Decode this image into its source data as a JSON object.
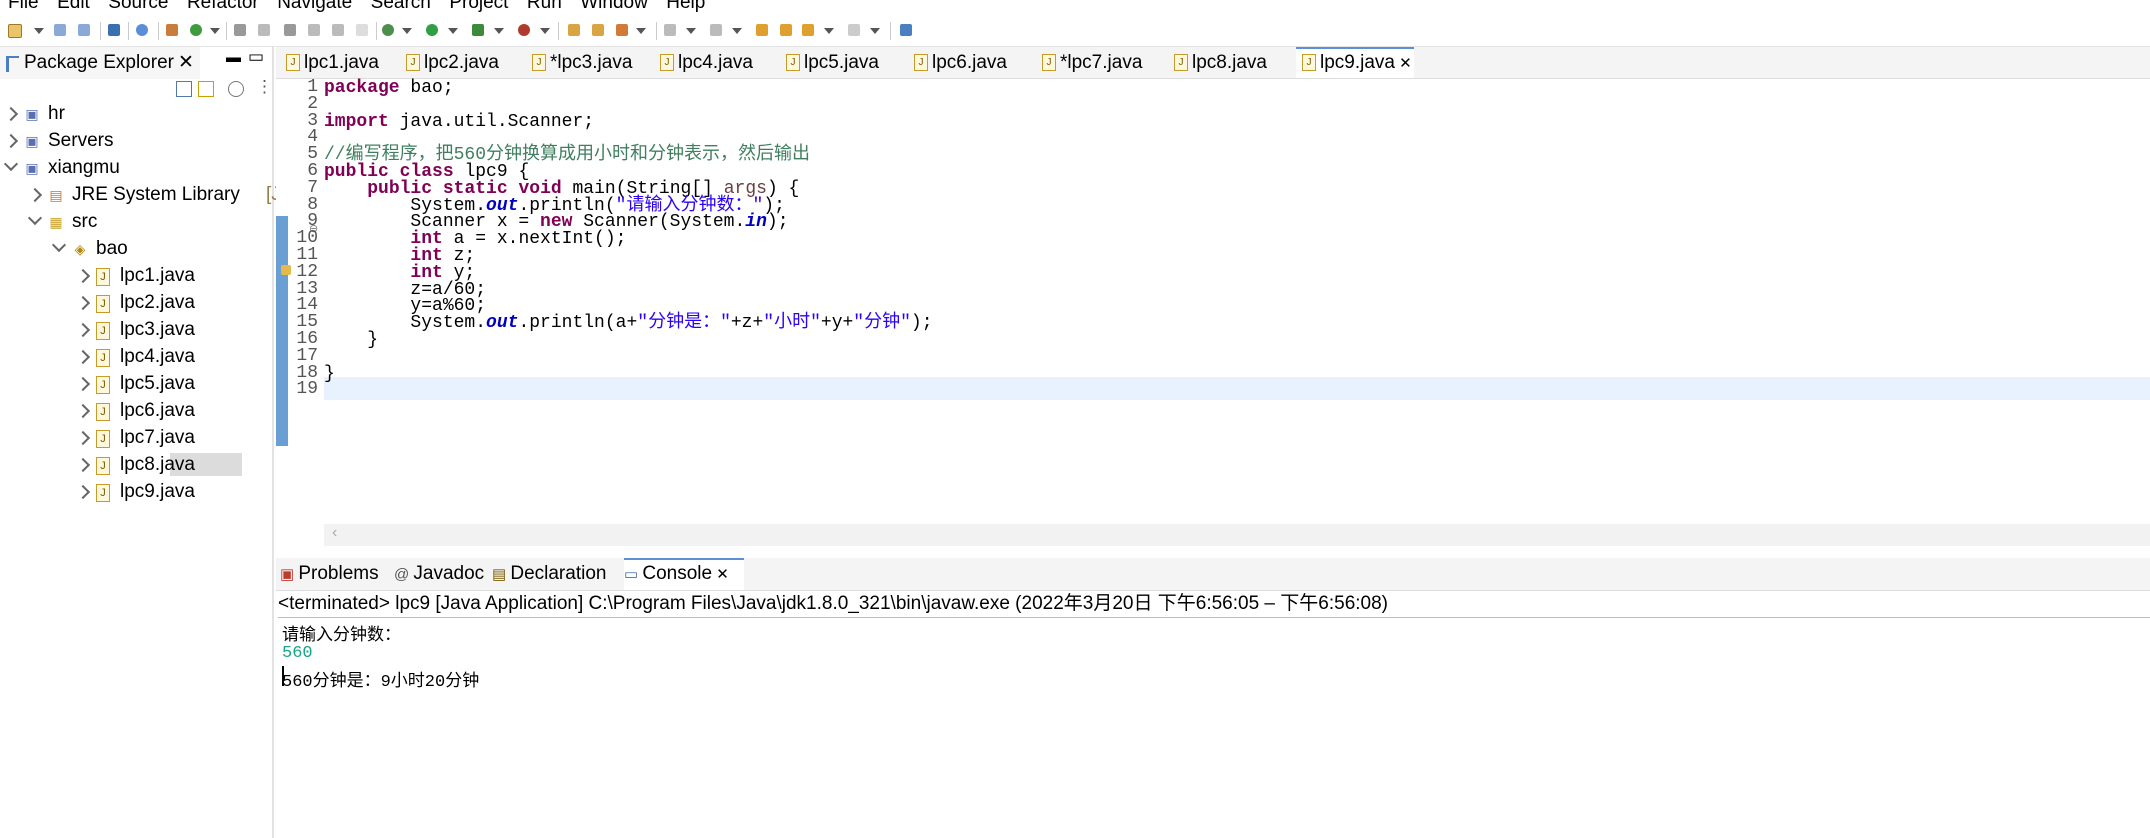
{
  "menu": [
    "File",
    "Edit",
    "Source",
    "Refactor",
    "Navigate",
    "Search",
    "Project",
    "Run",
    "Window",
    "Help"
  ],
  "package_explorer": {
    "title": "Package Explorer",
    "tree": [
      {
        "label": "hr",
        "depth": 0,
        "expanded": false
      },
      {
        "label": "Servers",
        "depth": 0,
        "expanded": false
      },
      {
        "label": "xiangmu",
        "depth": 0,
        "expanded": true
      },
      {
        "label": "JRE System Library",
        "suffix": "[Jav",
        "depth": 1,
        "expanded": false
      },
      {
        "label": "src",
        "depth": 1,
        "expanded": true
      },
      {
        "label": "bao",
        "depth": 2,
        "expanded": true
      },
      {
        "label": "lpc1.java",
        "depth": 3,
        "expanded": false
      },
      {
        "label": "lpc2.java",
        "depth": 3,
        "expanded": false
      },
      {
        "label": "lpc3.java",
        "depth": 3,
        "expanded": false
      },
      {
        "label": "lpc4.java",
        "depth": 3,
        "expanded": false
      },
      {
        "label": "lpc5.java",
        "depth": 3,
        "expanded": false
      },
      {
        "label": "lpc6.java",
        "depth": 3,
        "expanded": false
      },
      {
        "label": "lpc7.java",
        "depth": 3,
        "expanded": false
      },
      {
        "label": "lpc8.java",
        "depth": 3,
        "expanded": false,
        "selected": true
      },
      {
        "label": "lpc9.java",
        "depth": 3,
        "expanded": false
      }
    ]
  },
  "editor_tabs": [
    {
      "label": "lpc1.java"
    },
    {
      "label": "lpc2.java"
    },
    {
      "label": "*lpc3.java"
    },
    {
      "label": "lpc4.java"
    },
    {
      "label": "lpc5.java"
    },
    {
      "label": "lpc6.java"
    },
    {
      "label": "*lpc7.java"
    },
    {
      "label": "lpc8.java"
    },
    {
      "label": "lpc9.java",
      "active": true
    }
  ],
  "code_lines": [
    "package bao;",
    "",
    "import java.util.Scanner;",
    "",
    "//编写程序，把560分钟换算成用小时和分钟表示，然后输出",
    "public class lpc9 {",
    "    public static void main(String[] args) {",
    "        System.out.println(\"请输入分钟数：\");",
    "        Scanner x = new Scanner(System.in);",
    "        int a = x.nextInt();",
    "        int z;",
    "        int y;",
    "        z=a/60;",
    "        y=a%60;",
    "        System.out.println(a+\"分钟是：\"+z+\"小时\"+y+\"分钟\");",
    "    }",
    "",
    "}",
    ""
  ],
  "bottom_tabs": [
    {
      "label": "Problems"
    },
    {
      "label": "Javadoc"
    },
    {
      "label": "Declaration"
    },
    {
      "label": "Console",
      "active": true
    }
  ],
  "console": {
    "header": "<terminated> lpc9 [Java Application] C:\\Program Files\\Java\\jdk1.8.0_321\\bin\\javaw.exe  (2022年3月20日 下午6:56:05 – 下午6:56:08)",
    "lines": [
      "请输入分钟数：",
      "560",
      "560分钟是：9小时20分钟"
    ],
    "input_color": "#17a589"
  }
}
